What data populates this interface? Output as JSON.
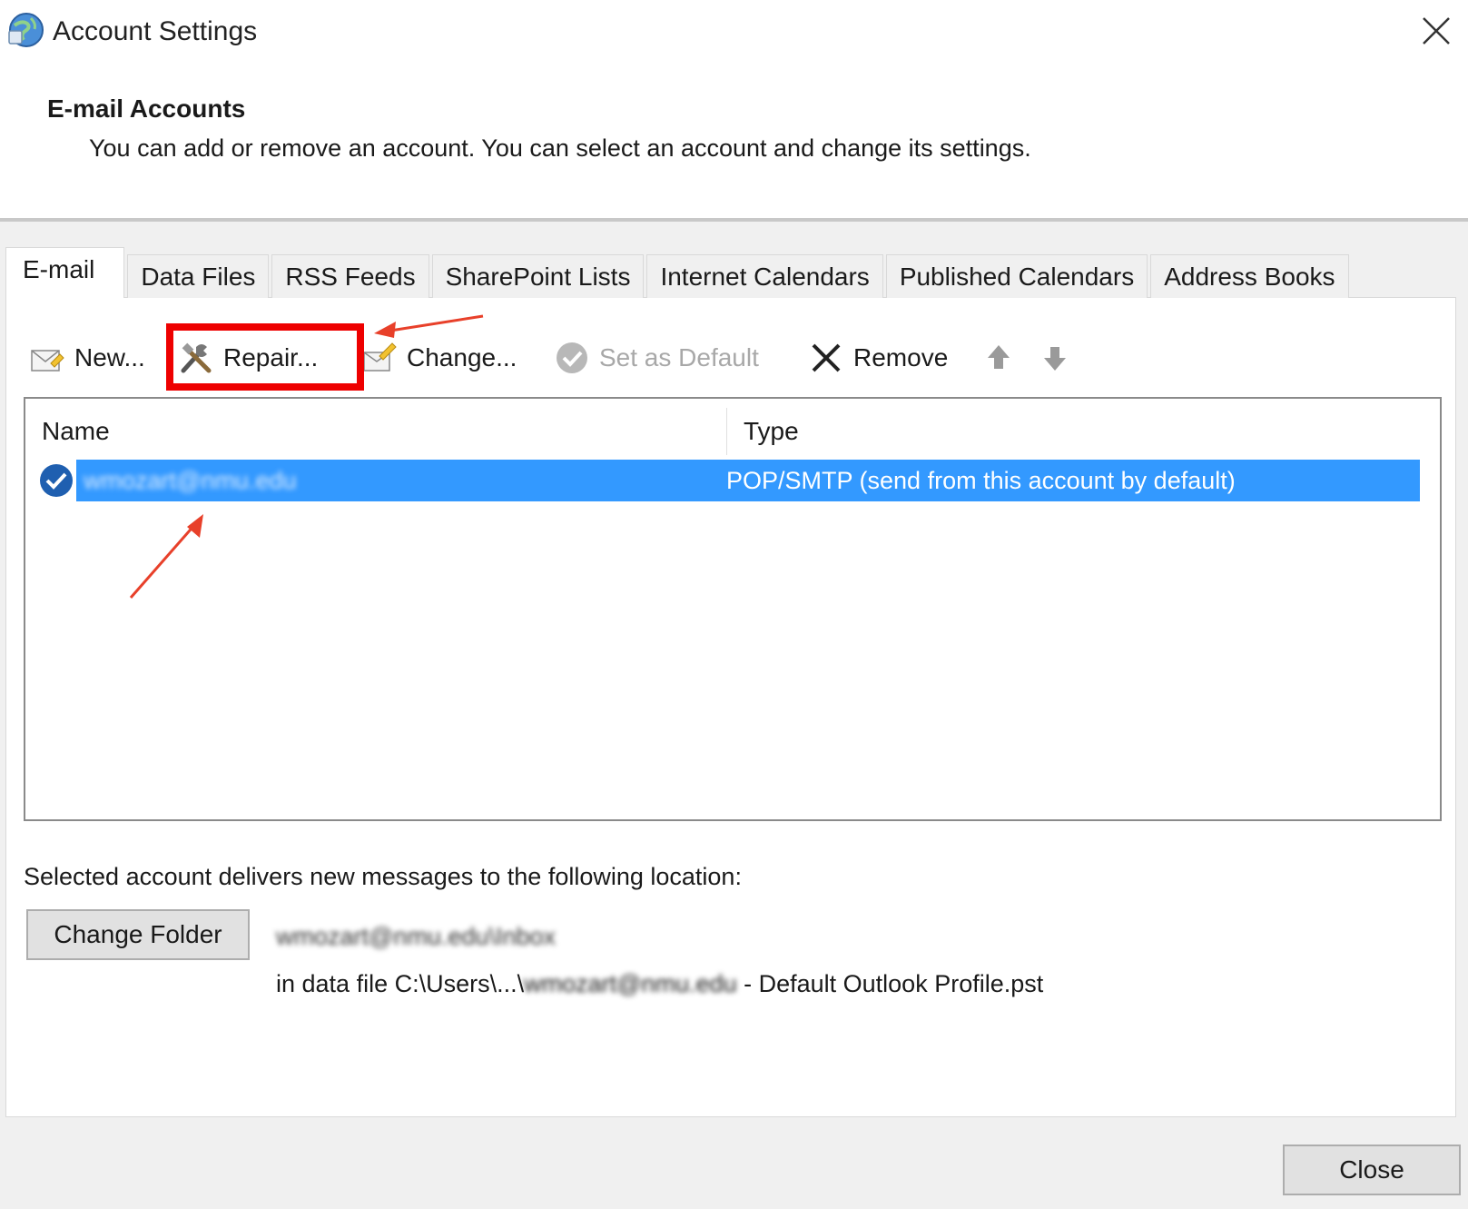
{
  "window": {
    "title": "Account Settings",
    "app_icon": "outlook-globe-icon",
    "close_icon": "close-icon"
  },
  "header": {
    "title": "E-mail Accounts",
    "subtitle": "You can add or remove an account. You can select an account and change its settings."
  },
  "tabs": [
    {
      "label": "E-mail",
      "active": true
    },
    {
      "label": "Data Files"
    },
    {
      "label": "RSS Feeds"
    },
    {
      "label": "SharePoint Lists"
    },
    {
      "label": "Internet Calendars"
    },
    {
      "label": "Published Calendars"
    },
    {
      "label": "Address Books"
    }
  ],
  "toolbar": {
    "new": {
      "label": "New...",
      "icon": "new-mail-icon"
    },
    "repair": {
      "label": "Repair...",
      "icon": "tools-icon"
    },
    "change": {
      "label": "Change...",
      "icon": "change-mail-icon"
    },
    "set_default": {
      "label": "Set as Default",
      "icon": "check-circle-icon",
      "enabled": false
    },
    "remove": {
      "label": "Remove",
      "icon": "x-icon"
    },
    "move_up": {
      "icon": "arrow-up-icon",
      "enabled": false
    },
    "move_down": {
      "icon": "arrow-down-icon",
      "enabled": false
    }
  },
  "accounts_table": {
    "columns": [
      "Name",
      "Type"
    ],
    "rows": [
      {
        "name": "wmozart@nmu.edu",
        "type": "POP/SMTP (send from this account by default)",
        "default": true,
        "selected": true
      }
    ]
  },
  "delivery": {
    "label": "Selected account delivers new messages to the following location:",
    "change_folder_label": "Change Folder",
    "folder": "wmozart@nmu.edu\\Inbox",
    "data_file_prefix": "in data file C:\\Users\\...\\",
    "data_file_user": "wmozart@nmu.edu",
    "data_file_suffix": " - Default Outlook Profile.pst"
  },
  "footer": {
    "close_label": "Close"
  },
  "colors": {
    "selection": "#3399ff",
    "annotation": "#ee0000",
    "dialog_bg": "#f0f0f0"
  }
}
